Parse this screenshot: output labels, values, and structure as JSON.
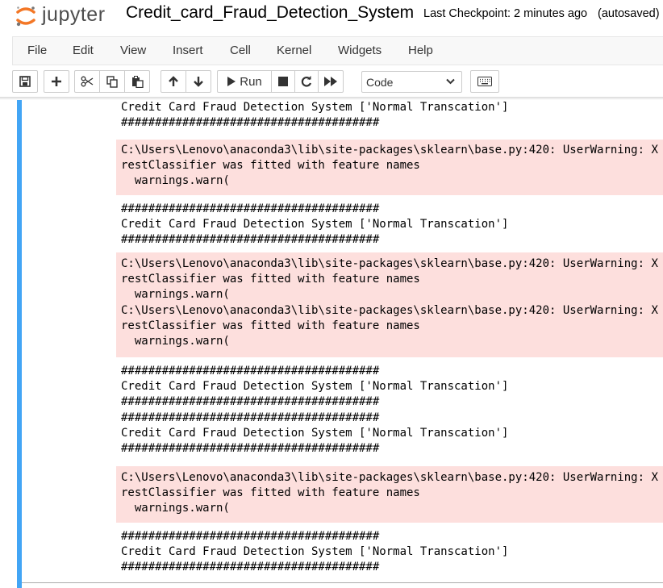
{
  "header": {
    "logo_text": "jupyter",
    "notebook_name": "Credit_card_Fraud_Detection_System",
    "checkpoint": "Last Checkpoint: 2 minutes ago",
    "autosave": "(autosaved)"
  },
  "menu": [
    "File",
    "Edit",
    "View",
    "Insert",
    "Cell",
    "Kernel",
    "Widgets",
    "Help"
  ],
  "toolbar": {
    "buttons": [
      "save-icon",
      "plus-icon",
      "cut-icon",
      "copy-icon",
      "paste-icon",
      "arrow-up-icon",
      "arrow-down-icon",
      "run-icon",
      "stop-icon",
      "restart-icon",
      "fast-forward-icon",
      "keyboard-icon"
    ],
    "run_label": "Run",
    "cell_type": "Code"
  },
  "output": [
    {
      "stream": "stdout",
      "text": "Credit Card Fraud Detection System ['Normal Transcation']\n######################################"
    },
    {
      "stream": "stderr",
      "text": "C:\\Users\\Lenovo\\anaconda3\\lib\\site-packages\\sklearn\\base.py:420: UserWarning: X does not have valid feature names, but RandomFo\nrestClassifier was fitted with feature names\n  warnings.warn("
    },
    {
      "stream": "stdout",
      "text": "######################################\nCredit Card Fraud Detection System ['Normal Transcation']\n######################################"
    },
    {
      "stream": "stderr",
      "text": "C:\\Users\\Lenovo\\anaconda3\\lib\\site-packages\\sklearn\\base.py:420: UserWarning: X does not have valid feature names, but RandomFo\nrestClassifier was fitted with feature names\n  warnings.warn(\nC:\\Users\\Lenovo\\anaconda3\\lib\\site-packages\\sklearn\\base.py:420: UserWarning: X does not have valid feature names, but RandomFo\nrestClassifier was fitted with feature names\n  warnings.warn("
    },
    {
      "stream": "stdout",
      "text": "######################################\nCredit Card Fraud Detection System ['Normal Transcation']\n######################################\n######################################\nCredit Card Fraud Detection System ['Normal Transcation']\n######################################"
    },
    {
      "stream": "stderr",
      "text": "C:\\Users\\Lenovo\\anaconda3\\lib\\site-packages\\sklearn\\base.py:420: UserWarning: X does not have valid feature names, but RandomFo\nrestClassifier was fitted with feature names\n  warnings.warn("
    },
    {
      "stream": "stdout",
      "text": "######################################\nCredit Card Fraud Detection System ['Normal Transcation']\n######################################"
    }
  ],
  "colors": {
    "cell_selected_bar": "#42a5f5",
    "stderr_background": "#fddfdd",
    "logo_orange": "#f37726"
  }
}
